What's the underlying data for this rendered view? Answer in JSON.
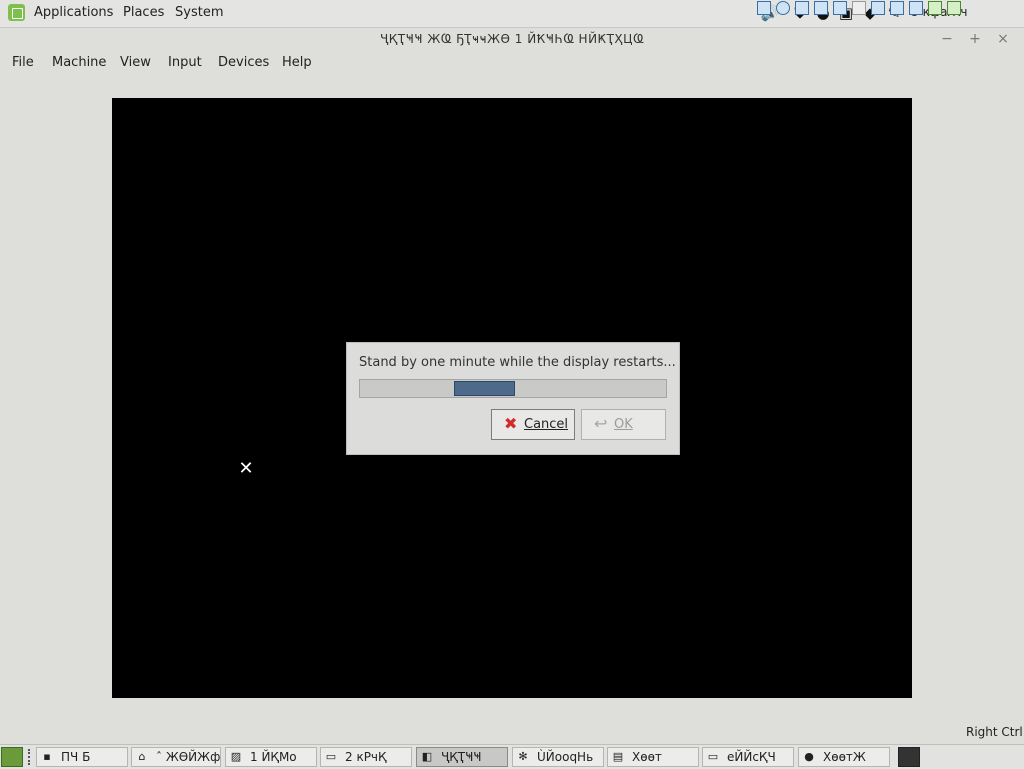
{
  "top_panel": {
    "menus": [
      "Applications",
      "Places",
      "System"
    ],
    "clock": "Ŭ кфаЖч",
    "tray_icons": [
      "volume-icon",
      "shield-icon",
      "obs-icon",
      "clipboard-icon",
      "firefox-icon",
      "pen-icon"
    ]
  },
  "window": {
    "title": "ҶҚҬҸҸ ЖҨ   ҔҬҹҹЖӨ  1 ЙҞҸҺҨ  НЙҜҬҲЦҨ",
    "minimize": "−",
    "maximize": "+",
    "close": "×"
  },
  "menubar": [
    "File",
    "Machine",
    "View",
    "Input",
    "Devices",
    "Help"
  ],
  "dialog": {
    "message": "Stand by one minute while the display restarts...",
    "progress": 0.2,
    "cancel_label": "Cancel",
    "ok_label": "OK"
  },
  "status": {
    "host_key": "Right Ctrl"
  },
  "taskbar": {
    "items": [
      {
        "label": "ПЧ  Б",
        "icon": "terminal-icon"
      },
      {
        "label": "ˆ ЖӨЙЖф",
        "icon": "home-icon"
      },
      {
        "label": "1 ЙҚМо",
        "icon": "image-icon"
      },
      {
        "label": "2 кРчҚ",
        "icon": "folder-icon"
      },
      {
        "label": "ҶҚҬҸҸ",
        "icon": "virtualbox-icon"
      },
      {
        "label": "ÙЙооqНь",
        "icon": "gear-icon"
      },
      {
        "label": "Хөөт",
        "icon": "notes-icon"
      },
      {
        "label": "еЙЙсҚЧ",
        "icon": "window-icon"
      },
      {
        "label": "ХөөтЖ",
        "icon": "obs-icon"
      }
    ]
  }
}
